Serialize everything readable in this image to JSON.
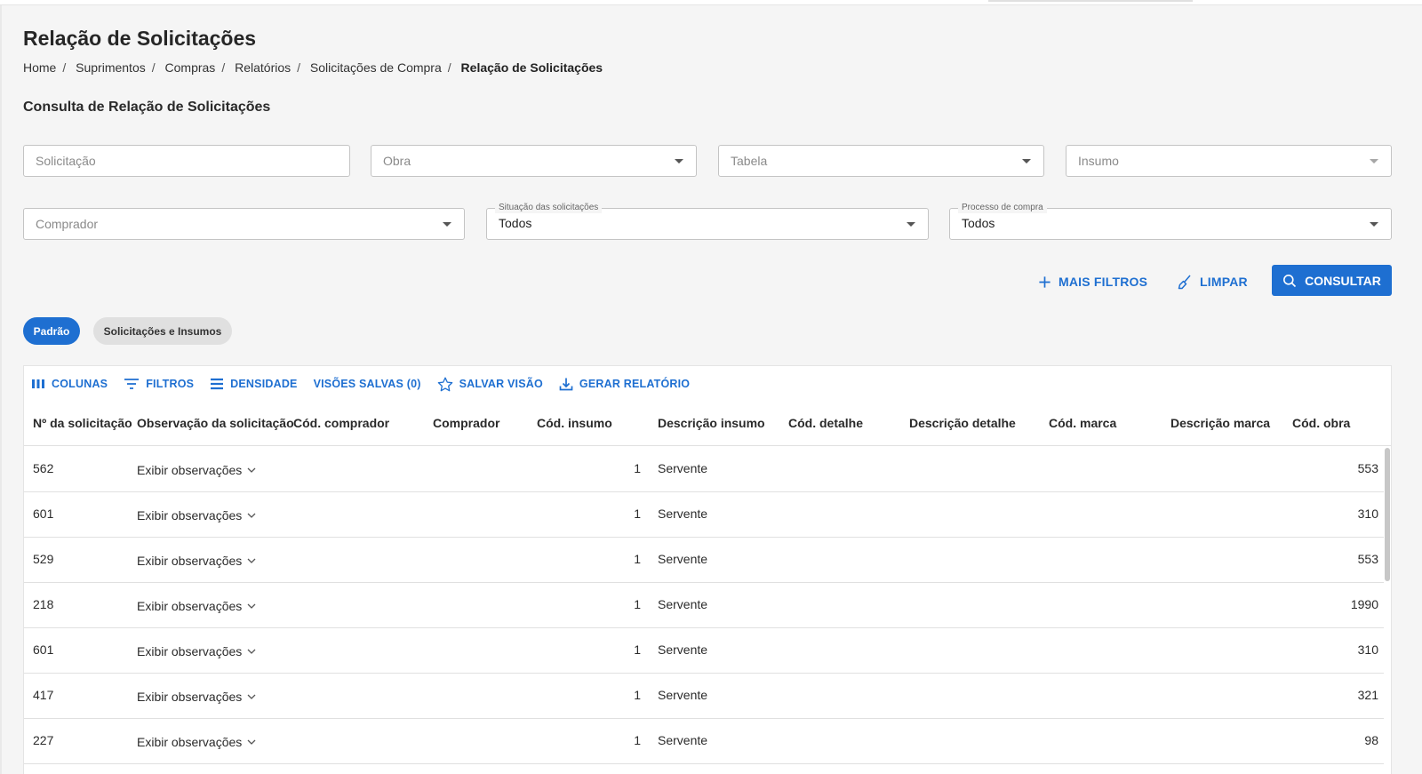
{
  "page": {
    "title": "Relação de Solicitações",
    "section_title": "Consulta de Relação de Solicitações"
  },
  "breadcrumb": [
    {
      "label": "Home"
    },
    {
      "label": "Suprimentos"
    },
    {
      "label": "Compras"
    },
    {
      "label": "Relatórios"
    },
    {
      "label": "Solicitações de Compra"
    },
    {
      "label": "Relação de Solicitações"
    }
  ],
  "filters": {
    "solicitacao": {
      "placeholder": "Solicitação"
    },
    "obra": {
      "placeholder": "Obra"
    },
    "tabela": {
      "placeholder": "Tabela"
    },
    "insumo": {
      "placeholder": "Insumo"
    },
    "comprador": {
      "placeholder": "Comprador"
    },
    "situacao": {
      "label": "Situação das solicitações",
      "value": "Todos"
    },
    "processo": {
      "label": "Processo de compra",
      "value": "Todos"
    }
  },
  "actions": {
    "more_filters": "MAIS FILTROS",
    "clear": "LIMPAR",
    "search": "CONSULTAR"
  },
  "views": {
    "active": "Padrão",
    "inactive": "Solicitações e Insumos"
  },
  "toolbar": {
    "columns": "COLUNAS",
    "filters": "FILTROS",
    "density": "DENSIDADE",
    "saved_views": "VISÕES SALVAS (0)",
    "save_view": "SALVAR VISÃO",
    "report": "GERAR RELATÓRIO"
  },
  "table": {
    "columns": [
      "Nº da solicitação",
      "Observação da solicitação",
      "Cód. comprador",
      "Comprador",
      "Cód. insumo",
      "Descrição insumo",
      "Cód. detalhe",
      "Descrição detalhe",
      "Cód. marca",
      "Descrição marca",
      "Cód. obra"
    ],
    "rows": [
      {
        "num": "562",
        "obs": "Exibir observações",
        "cod_insumo": "1",
        "desc_insumo": "Servente",
        "cod_obra": "553"
      },
      {
        "num": "601",
        "obs": "Exibir observações",
        "cod_insumo": "1",
        "desc_insumo": "Servente",
        "cod_obra": "310"
      },
      {
        "num": "529",
        "obs": "Exibir observações",
        "cod_insumo": "1",
        "desc_insumo": "Servente",
        "cod_obra": "553"
      },
      {
        "num": "218",
        "obs": "Exibir observações",
        "cod_insumo": "1",
        "desc_insumo": "Servente",
        "cod_obra": "1990"
      },
      {
        "num": "601",
        "obs": "Exibir observações",
        "cod_insumo": "1",
        "desc_insumo": "Servente",
        "cod_obra": "310"
      },
      {
        "num": "417",
        "obs": "Exibir observações",
        "cod_insumo": "1",
        "desc_insumo": "Servente",
        "cod_obra": "321"
      },
      {
        "num": "227",
        "obs": "Exibir observações",
        "cod_insumo": "1",
        "desc_insumo": "Servente",
        "cod_obra": "98"
      }
    ]
  },
  "colors": {
    "primary": "#1e6fd1",
    "background": "#f5f5f5",
    "chip_inactive": "#e0e0e0"
  },
  "icons": {
    "more_filters": "plus-icon",
    "clear": "broom-icon",
    "search": "search-icon",
    "columns": "columns-icon",
    "filters": "filter-icon",
    "density": "density-icon",
    "save_view": "star-icon",
    "report": "download-icon",
    "dropdown": "caret-down-icon",
    "expand": "chevron-down-icon"
  }
}
